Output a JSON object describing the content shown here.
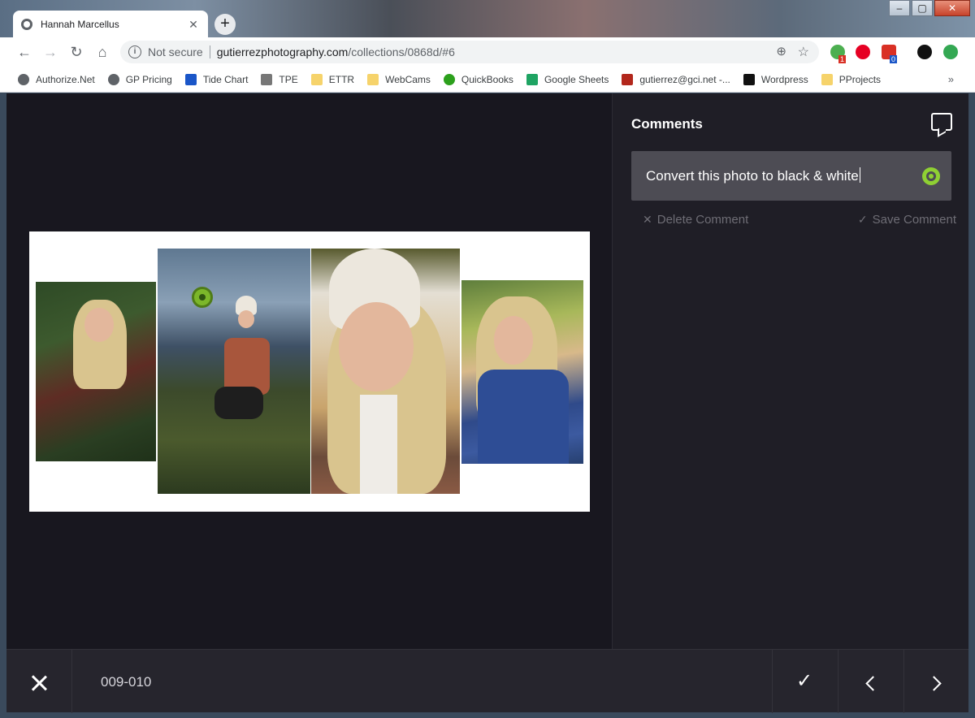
{
  "browser": {
    "tab_title": "Hannah Marcellus",
    "tab_close": "✕",
    "new_tab": "+",
    "security_label": "Not secure",
    "url_host": "gutierrezphotography.com",
    "url_path": "/collections/0868d/#6",
    "ext_badges": [
      "1",
      "0"
    ]
  },
  "bookmarks": [
    {
      "label": "Authorize.Net",
      "icon": "globe-icon",
      "color": "#5f6368"
    },
    {
      "label": "GP Pricing",
      "icon": "globe-icon",
      "color": "#5f6368"
    },
    {
      "label": "Tide Chart",
      "icon": "tide-icon",
      "color": "#1a56c8"
    },
    {
      "label": "TPE",
      "icon": "tpe-icon",
      "color": "#777777"
    },
    {
      "label": "ETTR",
      "icon": "folder-icon",
      "color": "#f6d36b"
    },
    {
      "label": "WebCams",
      "icon": "folder-icon",
      "color": "#f6d36b"
    },
    {
      "label": "QuickBooks",
      "icon": "quickbooks-icon",
      "color": "#2ca01c"
    },
    {
      "label": "Google Sheets",
      "icon": "sheets-icon",
      "color": "#1fa463"
    },
    {
      "label": "gutierrez@gci.net -...",
      "icon": "g-icon",
      "color": "#b2271c"
    },
    {
      "label": "Wordpress",
      "icon": "gp-icon",
      "color": "#111111"
    },
    {
      "label": "PProjects",
      "icon": "folder-icon",
      "color": "#f6d36b"
    }
  ],
  "bookmarks_more": "»",
  "panel": {
    "title": "Comments",
    "comment_text": "Convert this photo to black & white",
    "delete_label": "Delete Comment",
    "save_label": "Save Comment"
  },
  "bottom": {
    "spread_label": "009-010"
  },
  "colors": {
    "accent_green": "#8fd033",
    "app_bg": "#18171f",
    "panel_bg": "#1f1e26"
  }
}
